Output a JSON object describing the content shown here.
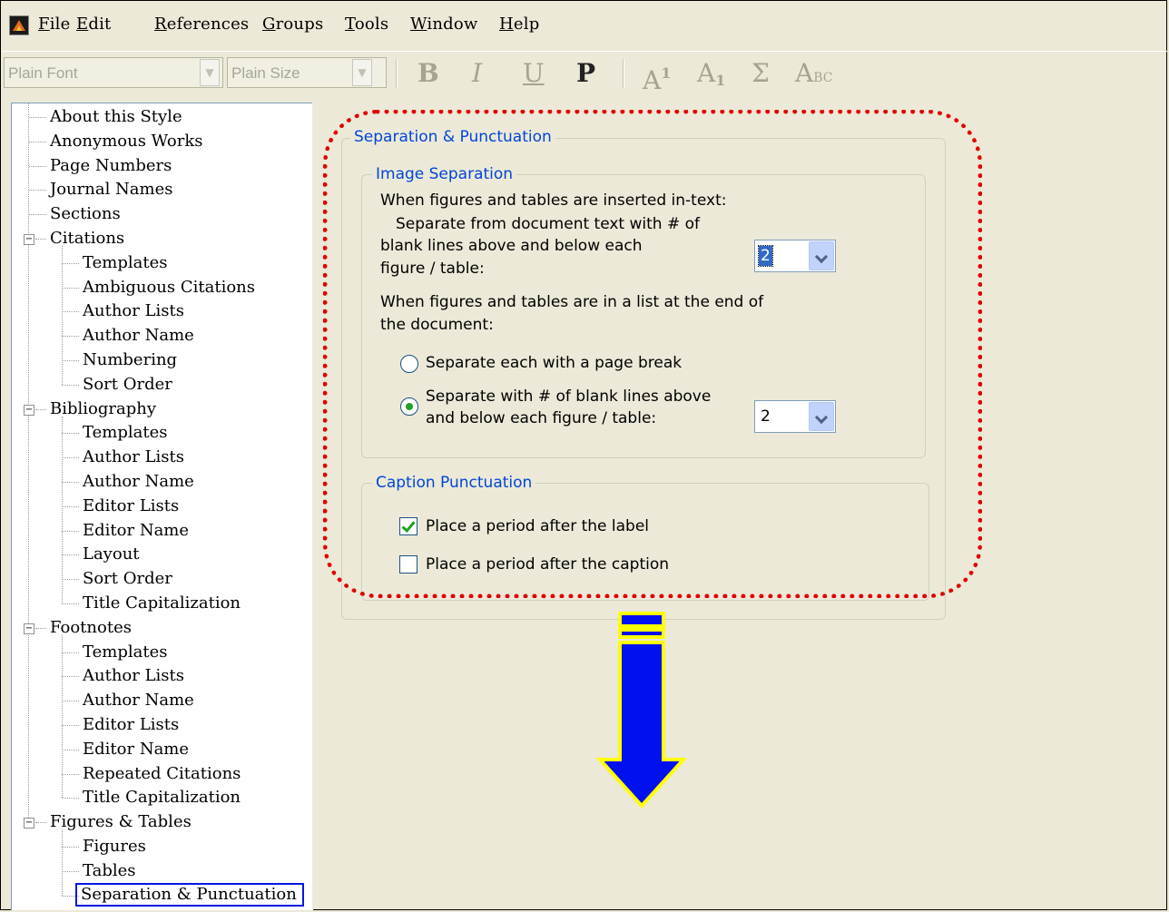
{
  "menubar": {
    "items": [
      "File",
      "Edit",
      "References",
      "Groups",
      "Tools",
      "Window",
      "Help"
    ]
  },
  "toolbar": {
    "font_value": "Plain Font",
    "size_value": "Plain Size",
    "bold": "B",
    "italic": "I",
    "underline": "U",
    "plain": "P",
    "superscript": "A",
    "superscript_mark": "1",
    "subscript": "A",
    "subscript_mark": "1",
    "symbol": "Σ",
    "smallcaps": "A",
    "smallcaps_mark": "BC"
  },
  "tree": {
    "items": [
      {
        "label": "About this Style",
        "level": 0
      },
      {
        "label": "Anonymous Works",
        "level": 0
      },
      {
        "label": "Page Numbers",
        "level": 0
      },
      {
        "label": "Journal Names",
        "level": 0
      },
      {
        "label": "Sections",
        "level": 0
      },
      {
        "label": "Citations",
        "level": 0,
        "expanded": true
      },
      {
        "label": "Templates",
        "level": 1
      },
      {
        "label": "Ambiguous Citations",
        "level": 1
      },
      {
        "label": "Author Lists",
        "level": 1
      },
      {
        "label": "Author Name",
        "level": 1
      },
      {
        "label": "Numbering",
        "level": 1
      },
      {
        "label": "Sort Order",
        "level": 1
      },
      {
        "label": "Bibliography",
        "level": 0,
        "expanded": true
      },
      {
        "label": "Templates",
        "level": 1
      },
      {
        "label": "Author Lists",
        "level": 1
      },
      {
        "label": "Author Name",
        "level": 1
      },
      {
        "label": "Editor Lists",
        "level": 1
      },
      {
        "label": "Editor Name",
        "level": 1
      },
      {
        "label": "Layout",
        "level": 1
      },
      {
        "label": "Sort Order",
        "level": 1
      },
      {
        "label": "Title Capitalization",
        "level": 1
      },
      {
        "label": "Footnotes",
        "level": 0,
        "expanded": true
      },
      {
        "label": "Templates",
        "level": 1
      },
      {
        "label": "Author Lists",
        "level": 1
      },
      {
        "label": "Author Name",
        "level": 1
      },
      {
        "label": "Editor Lists",
        "level": 1
      },
      {
        "label": "Editor Name",
        "level": 1
      },
      {
        "label": "Repeated Citations",
        "level": 1
      },
      {
        "label": "Title Capitalization",
        "level": 1
      },
      {
        "label": "Figures & Tables",
        "level": 0,
        "expanded": true
      },
      {
        "label": "Figures",
        "level": 1
      },
      {
        "label": "Tables",
        "level": 1
      },
      {
        "label": "Separation & Punctuation",
        "level": 1,
        "selected": true
      }
    ]
  },
  "pane": {
    "group_title": "Separation & Punctuation",
    "image_separation": {
      "title": "Image Separation",
      "intext_label": "When figures and tables are inserted in-text:",
      "intext_desc_line1": "Separate from document text with # of",
      "intext_desc_line2": "blank lines above and below each",
      "intext_desc_line3": "figure / table:",
      "intext_value": "2",
      "endlist_line1": "When figures and tables are in a list at the end of",
      "endlist_line2": "the document:",
      "radio_pagebreak": "Separate each with a page break",
      "radio_blanklines_line1": "Separate with # of blank lines above",
      "radio_blanklines_line2": "and below each figure / table:",
      "selected_radio": "blanklines",
      "endlist_value": "2"
    },
    "caption_punctuation": {
      "title": "Caption Punctuation",
      "period_after_label": "Place a period after the label",
      "period_after_label_checked": true,
      "period_after_caption": "Place a period after the caption",
      "period_after_caption_checked": false
    }
  },
  "colors": {
    "highlight_border": "#e00000",
    "arrow_fill": "#0010ee",
    "arrow_outline": "#ffff00",
    "legend_text": "#0046d5"
  }
}
